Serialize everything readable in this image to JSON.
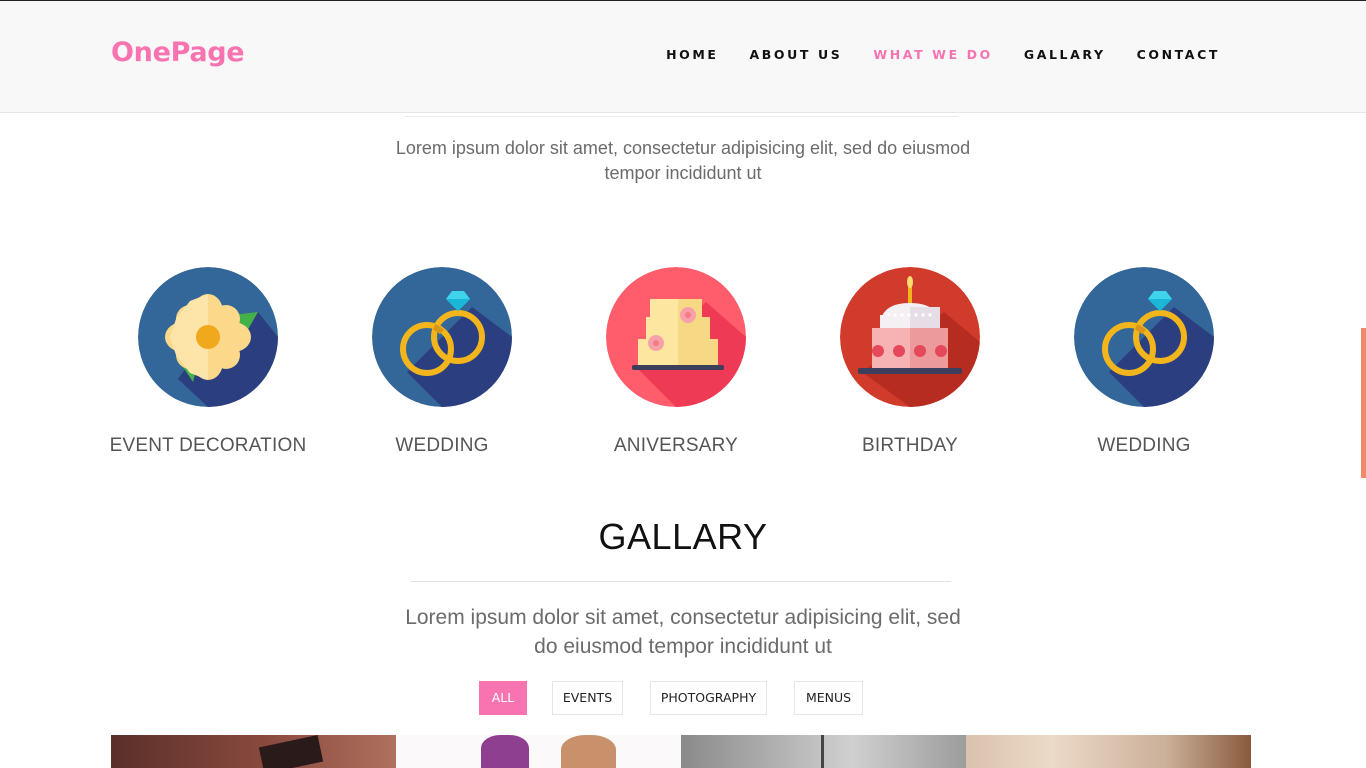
{
  "header": {
    "logo": "OnePage",
    "nav": [
      {
        "label": "HOME",
        "active": false
      },
      {
        "label": "ABOUT US",
        "active": false
      },
      {
        "label": "WHAT WE DO",
        "active": true
      },
      {
        "label": "GALLARY",
        "active": false
      },
      {
        "label": "CONTACT",
        "active": false
      }
    ]
  },
  "services": {
    "intro": "Lorem ipsum dolor sit amet, consectetur adipisicing elit, sed do eiusmod tempor incididunt ut",
    "items": [
      {
        "label": "EVENT DECORATION",
        "icon": "flower-icon",
        "color": "#2f6aa0"
      },
      {
        "label": "WEDDING",
        "icon": "rings-icon",
        "color": "#2f6aa0"
      },
      {
        "label": "ANIVERSARY",
        "icon": "cake-icon",
        "color": "#ff5a6e"
      },
      {
        "label": "BIRTHDAY",
        "icon": "birthday-cake-icon",
        "color": "#cc3a2a"
      },
      {
        "label": "WEDDING",
        "icon": "rings-icon",
        "color": "#2f6aa0"
      }
    ]
  },
  "gallery": {
    "title": "GALLARY",
    "subtitle": "Lorem ipsum dolor sit amet, consectetur adipisicing elit, sed do eiusmod tempor incididunt ut",
    "filters": [
      {
        "label": "ALL",
        "active": true
      },
      {
        "label": "EVENTS",
        "active": false
      },
      {
        "label": "PHOTOGRAPHY",
        "active": false
      },
      {
        "label": "MENUS",
        "active": false
      }
    ]
  },
  "colors": {
    "accent": "#f774b1",
    "text_dark": "#111111",
    "text_muted": "#6b6b6b"
  }
}
